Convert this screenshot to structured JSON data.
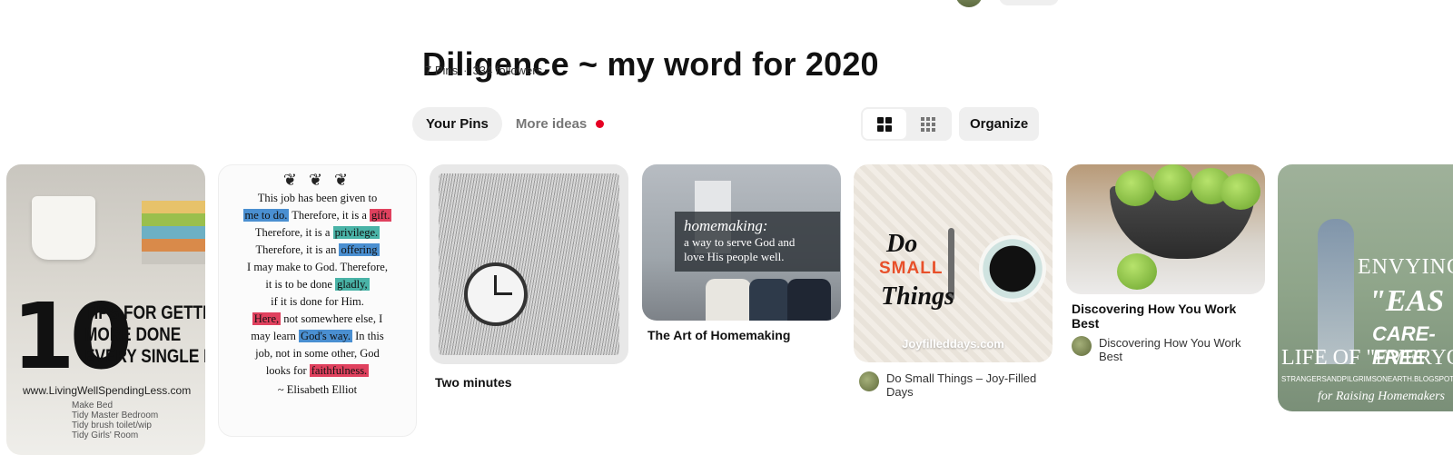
{
  "board": {
    "title": "Diligence ~ my word for 2020",
    "pins_count": "7 Pins",
    "separator": "·",
    "followers": "334 followers"
  },
  "tabs": [
    {
      "label": "Your Pins",
      "active": true
    },
    {
      "label": "More ideas",
      "active": false,
      "notification_dot": true
    }
  ],
  "toolbar": {
    "organize_label": "Organize",
    "view_modes": [
      "default-grid",
      "compact-grid"
    ],
    "active_view": "default-grid"
  },
  "colors": {
    "accent_red": "#e60023",
    "pill_bg": "#efefef"
  },
  "pins": [
    {
      "image_text": {
        "big": "10",
        "tips_lines": [
          "TIPS FOR GETTING",
          "MORE DONE",
          "EVERY SINGLE DAY"
        ],
        "url": "www.LivingWellSpendingLess.com",
        "note_lines": [
          "Make Bed",
          "Tidy Master Bedroom",
          "Tidy brush toilet/wip",
          "Tidy Girls' Room"
        ]
      }
    },
    {
      "image_text": {
        "quote_html_parts": [
          "This job has been given to",
          "me to do.",
          " Therefore, it is a ",
          "gift.",
          "Therefore, it is a ",
          "privilege.",
          "Therefore, it is an ",
          "offering",
          "I may make to God. Therefore,",
          "it is to be done ",
          "gladly,",
          "if it is done for Him.",
          "Here,",
          " not somewhere else, I",
          "may learn ",
          "God's way.",
          " In this",
          "job, not in some other, God",
          "looks for ",
          "faithfulness."
        ],
        "author": "~ Elisabeth Elliot"
      }
    },
    {
      "title": "Two minutes"
    },
    {
      "title": "The Art of Homemaking",
      "image_text": {
        "heading": "homemaking:",
        "line1": "a way to serve God and",
        "line2": "love His people well."
      }
    },
    {
      "attribution": "Do Small Things – Joy-Filled Days",
      "image_text": {
        "do": "Do",
        "small": "SMALL",
        "things": "Things",
        "brand": "Joyfilleddays.com"
      }
    },
    {
      "title": "Discovering How You Work Best",
      "attribution": "Discovering How You Work Best"
    },
    {
      "image_text": {
        "t1": "ENVYING TH",
        "t2": "\"EAS",
        "t3": "CARE-FREE",
        "t4": "LIFE OF \"EVERYONE ELSE",
        "t5": "STRANGERSANDPILGRIMSONEARTH.BLOGSPOT",
        "t6": "for Raising Homemakers"
      }
    }
  ]
}
